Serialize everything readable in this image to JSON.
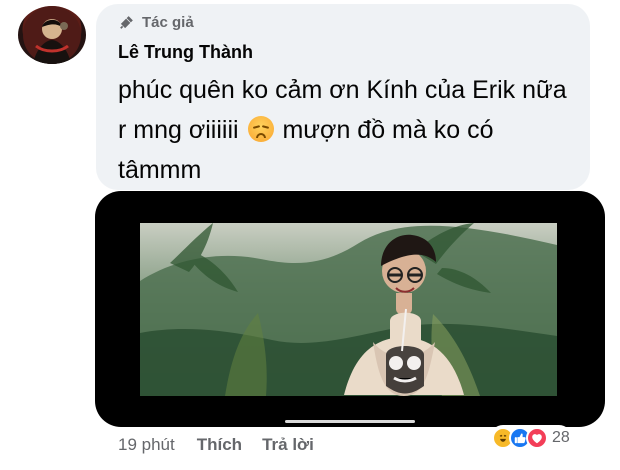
{
  "comment": {
    "badge": {
      "label": "Tác giả",
      "icon": "mic-icon"
    },
    "author": "Lê Trung Thành",
    "text_before_emoji": "phúc quên ko cảm ơn Kính của Erik nữa r mng ơiiiiii",
    "emoji": "disappointed-face-emoji",
    "text_after_emoji": "mượn đồ mà ko có tâmmm"
  },
  "actions": {
    "time": "19 phút",
    "like_label": "Thích",
    "reply_label": "Trả lời"
  },
  "reactions": {
    "icons": [
      "haha-icon",
      "like-icon",
      "love-icon"
    ],
    "count": "28"
  },
  "colors": {
    "bubble": "#eff2f5",
    "secondary_text": "#65676b",
    "like": "#1877f2",
    "love": "#f33e58",
    "haha": "#f7b928"
  }
}
